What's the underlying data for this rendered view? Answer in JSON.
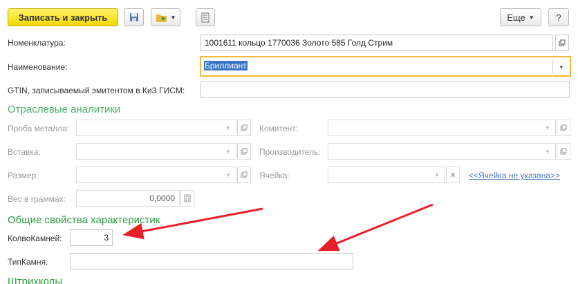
{
  "toolbar": {
    "save_close_label": "Записать и закрыть",
    "more_label": "Еще",
    "help_label": "?"
  },
  "fields": {
    "nomenclature": {
      "label": "Номенклатура:",
      "value": "1001611 кольцо 1770036 Золото 585 Голд Стрим"
    },
    "name": {
      "label": "Наименование:",
      "value": "Бриллиант"
    },
    "gtin": {
      "label": "GTIN, записываемый эмитентом в КиЗ ГИСМ:",
      "value": ""
    }
  },
  "industry_section": {
    "title": "Отраслевые аналитики",
    "metal_label": "Проба металла:",
    "insert_label": "Вставка:",
    "size_label": "Размер:",
    "weight_label": "Вес в граммах:",
    "weight_value": "0,0000",
    "consignor_label": "Комитент:",
    "manufacturer_label": "Производитель:",
    "cell_label": "Ячейка:",
    "cell_link": "<<Ячейка не указана>>"
  },
  "props_section": {
    "title": "Общие свойства характеристик",
    "stones_label": "КолвоКамней:",
    "stones_value": "3",
    "stone_type_label": "ТипКамня:",
    "stone_type_value": ""
  },
  "barcodes_section": {
    "title": "Штрихкоды"
  },
  "colors": {
    "accent_yellow": "#f2d800",
    "section_green": "#4cae6a",
    "focus_orange": "#f5b63a",
    "arrow_red": "#e8202a",
    "link_blue": "#4a7fbd"
  },
  "icons": [
    "save-icon",
    "folder-icon",
    "document-icon",
    "open-icon",
    "dropdown-icon",
    "clear-icon",
    "calculator-icon"
  ]
}
